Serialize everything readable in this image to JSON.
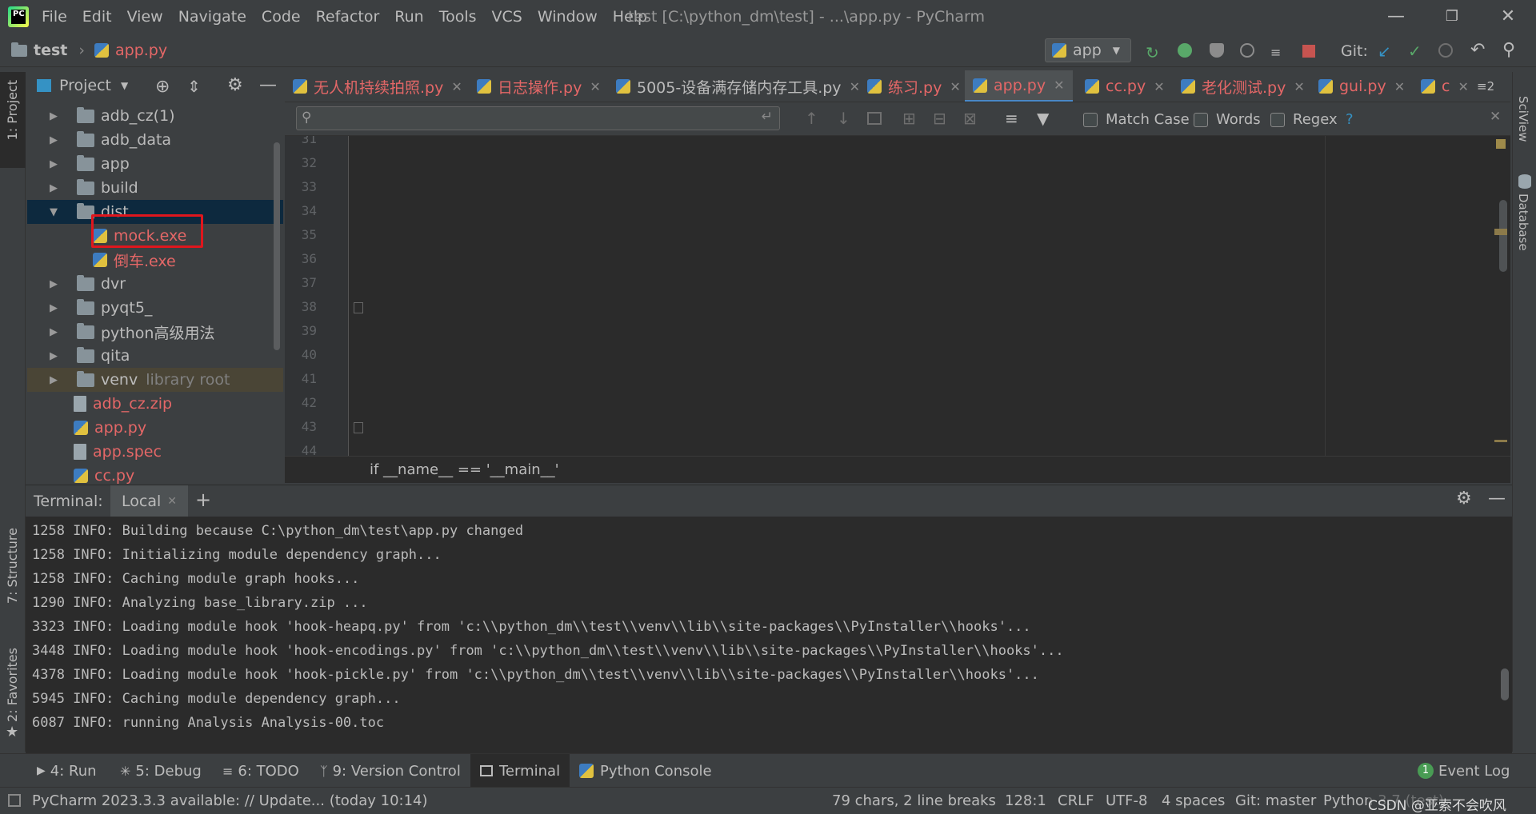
{
  "titlebar": {
    "menu": [
      "File",
      "Edit",
      "View",
      "Navigate",
      "Code",
      "Refactor",
      "Run",
      "Tools",
      "VCS",
      "Window",
      "Help"
    ],
    "window_title": "test [C:\\python_dm\\test] - ...\\app.py - PyCharm"
  },
  "navbar": {
    "project": "test",
    "file": "app.py",
    "run_config": "app",
    "git_label": "Git:"
  },
  "project_panel": {
    "title": "Project",
    "items": [
      {
        "label": "adb_cz(1)",
        "kind": "folder"
      },
      {
        "label": "adb_data",
        "kind": "folder"
      },
      {
        "label": "app",
        "kind": "folder"
      },
      {
        "label": "build",
        "kind": "folder"
      },
      {
        "label": "dist",
        "kind": "folder-open"
      },
      {
        "label": "mock.exe",
        "kind": "exe"
      },
      {
        "label": "倒车.exe",
        "kind": "exe"
      },
      {
        "label": "dvr",
        "kind": "folder"
      },
      {
        "label": "pyqt5_",
        "kind": "folder"
      },
      {
        "label": "python高级用法",
        "kind": "folder"
      },
      {
        "label": "qita",
        "kind": "folder"
      },
      {
        "label": "venv",
        "kind": "folder",
        "suffix": "library root"
      },
      {
        "label": "adb_cz.zip",
        "kind": "zip"
      },
      {
        "label": "app.py",
        "kind": "py"
      },
      {
        "label": "app.spec",
        "kind": "file"
      },
      {
        "label": "cc.py",
        "kind": "py"
      }
    ]
  },
  "left_strip": {
    "project": "1: Project",
    "structure": "7: Structure",
    "favorites": "2: Favorites"
  },
  "right_strip": {
    "sciview": "SciView",
    "database": "Database"
  },
  "tabs": [
    {
      "label": "无人机持续拍照.py"
    },
    {
      "label": "日志操作.py"
    },
    {
      "label": "5005-设备满存储内存工具.py"
    },
    {
      "label": "练习.py"
    },
    {
      "label": "app.py"
    },
    {
      "label": "cc.py"
    },
    {
      "label": "老化测试.py"
    },
    {
      "label": "gui.py"
    },
    {
      "label": "c"
    }
  ],
  "tabs_overflow": "2",
  "search": {
    "match_case": "Match Case",
    "words": "Words",
    "regex": "Regex",
    "help": "?"
  },
  "editor": {
    "line_numbers": [
      "31",
      "32",
      "33",
      "34",
      "35",
      "36",
      "37",
      "38",
      "39",
      "40",
      "41",
      "42",
      "43",
      "44"
    ],
    "breadcrumb": "if __name__ == '__main__'"
  },
  "terminal": {
    "title": "Terminal:",
    "tab": "Local",
    "lines": [
      "1258 INFO: Building because C:\\python_dm\\test\\app.py changed",
      "1258 INFO: Initializing module dependency graph...",
      "1258 INFO: Caching module graph hooks...",
      "1290 INFO: Analyzing base_library.zip ...",
      "3323 INFO: Loading module hook 'hook-heapq.py' from 'c:\\\\python_dm\\\\test\\\\venv\\\\lib\\\\site-packages\\\\PyInstaller\\\\hooks'...",
      "3448 INFO: Loading module hook 'hook-encodings.py' from 'c:\\\\python_dm\\\\test\\\\venv\\\\lib\\\\site-packages\\\\PyInstaller\\\\hooks'...",
      "4378 INFO: Loading module hook 'hook-pickle.py' from 'c:\\\\python_dm\\\\test\\\\venv\\\\lib\\\\site-packages\\\\PyInstaller\\\\hooks'...",
      "5945 INFO: Caching module dependency graph...",
      "6087 INFO: running Analysis Analysis-00.toc"
    ]
  },
  "bottom_tabs": [
    "4: Run",
    "5: Debug",
    "6: TODO",
    "9: Version Control",
    "Terminal",
    "Python Console"
  ],
  "event_log": {
    "count": "1",
    "label": "Event Log"
  },
  "status": {
    "message": "PyCharm 2023.3.3 available: // Update... (today 10:14)",
    "chars": "79 chars, 2 line breaks",
    "position": "128:1",
    "line_sep": "CRLF",
    "encoding": "UTF-8",
    "indent": "4 spaces",
    "git": "Git: master",
    "interpreter": "Python 3.7 (test)",
    "watermark": "CSDN @亚索不会吹风"
  },
  "colors": {
    "accent": "#4a88c7",
    "error_red": "#e46767",
    "highlight_box": "#e0161d",
    "selection": "#0d293e"
  }
}
